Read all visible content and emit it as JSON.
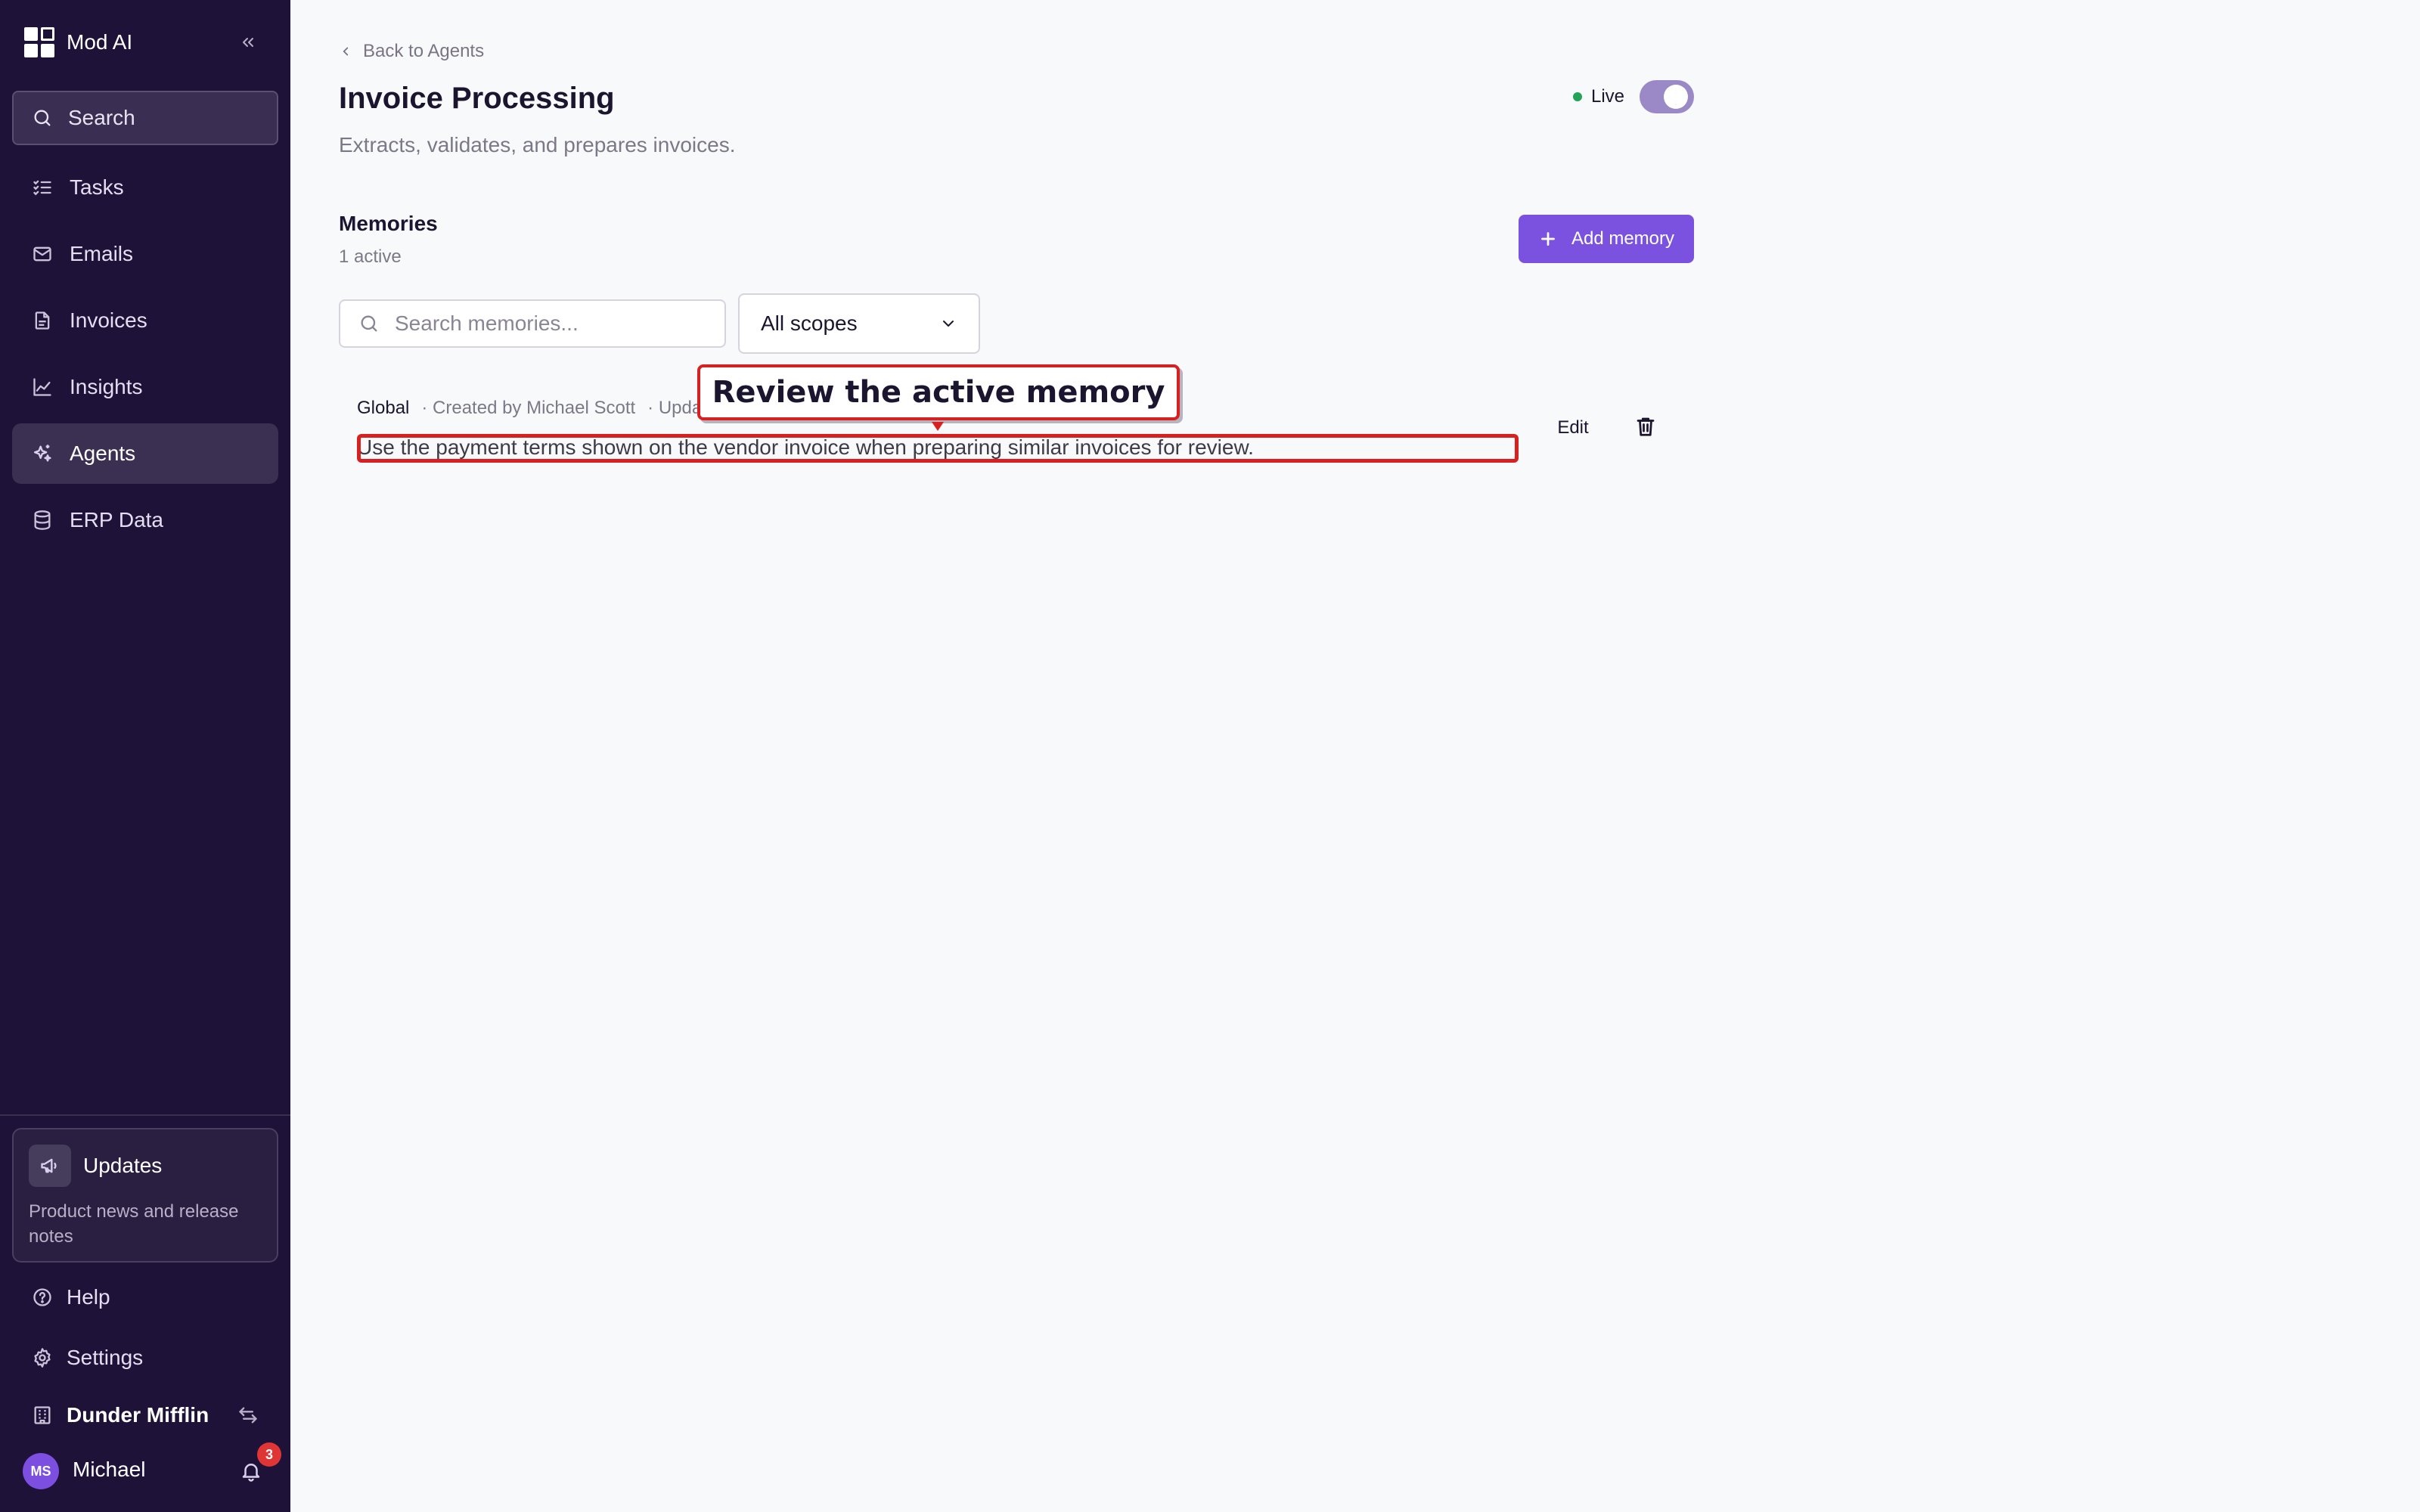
{
  "brand": {
    "name": "Mod AI"
  },
  "sidebar": {
    "search_label": "Search",
    "items": [
      {
        "label": "Tasks",
        "icon": "tasks-icon"
      },
      {
        "label": "Emails",
        "icon": "mail-icon"
      },
      {
        "label": "Invoices",
        "icon": "document-icon"
      },
      {
        "label": "Insights",
        "icon": "chart-line-icon"
      },
      {
        "label": "Agents",
        "icon": "sparkles-icon",
        "active": true
      },
      {
        "label": "ERP Data",
        "icon": "database-icon"
      }
    ],
    "updates": {
      "title": "Updates",
      "description": "Product news and release notes"
    },
    "help_label": "Help",
    "settings_label": "Settings",
    "org_name": "Dunder Mifflin",
    "user": {
      "initials": "MS",
      "name": "Michael",
      "notification_count": "3"
    }
  },
  "main": {
    "back_label": "Back to Agents",
    "title": "Invoice Processing",
    "subtitle": "Extracts, validates, and prepares invoices.",
    "status_label": "Live",
    "live_enabled": true,
    "memories": {
      "title": "Memories",
      "count_label": "1 active",
      "add_label": "Add memory",
      "search_placeholder": "Search memories...",
      "scope_filter": "All scopes",
      "items": [
        {
          "scope": "Global",
          "created_by": "· Created by Michael Scott",
          "updated": "· Upda",
          "text": "Use the payment terms shown on the vendor invoice when preparing similar invoices for review.",
          "edit_label": "Edit"
        }
      ]
    }
  },
  "annotation": {
    "label": "Review the active memory"
  },
  "colors": {
    "sidebar_bg": "#1f1239",
    "accent": "#7b52e0",
    "live_green": "#21a35a",
    "highlight_red": "#d92020",
    "badge_red": "#e03535"
  }
}
